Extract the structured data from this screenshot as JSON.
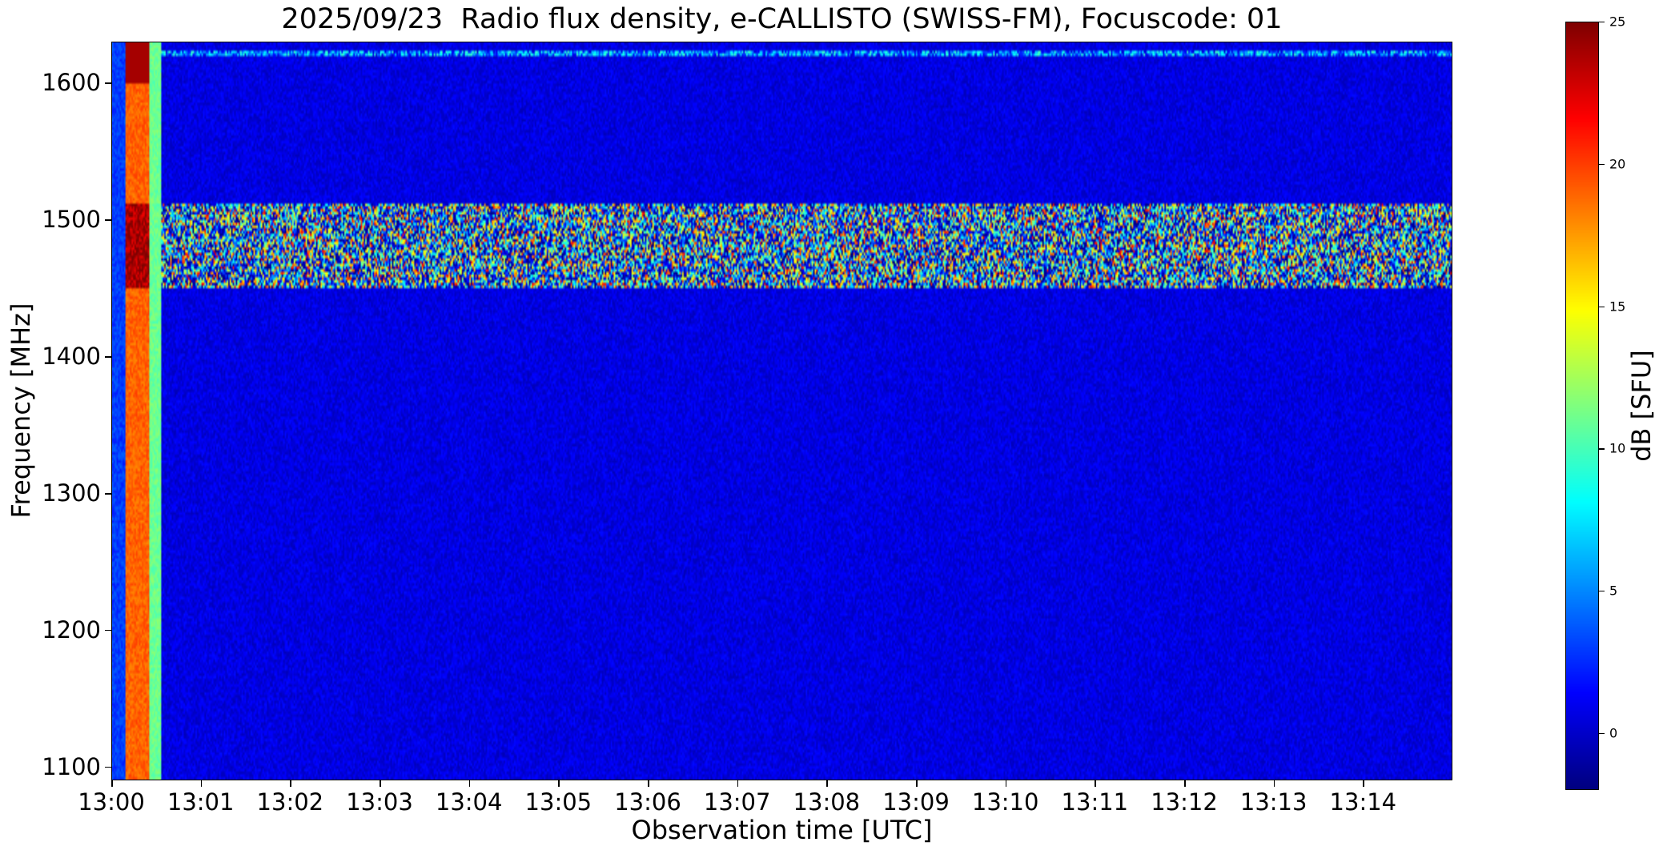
{
  "chart_data": {
    "type": "heatmap",
    "title": "2025/09/23  Radio flux density, e-CALLISTO (SWISS-FM), Focuscode: 01",
    "xlabel": "Observation time [UTC]",
    "ylabel": "Frequency [MHz]",
    "xlim": [
      "13:00",
      "13:15"
    ],
    "ylim": [
      1090,
      1630
    ],
    "x_ticks": [
      "13:00",
      "13:01",
      "13:02",
      "13:03",
      "13:04",
      "13:05",
      "13:06",
      "13:07",
      "13:08",
      "13:09",
      "13:10",
      "13:11",
      "13:12",
      "13:13",
      "13:14"
    ],
    "y_ticks": [
      1100,
      1200,
      1300,
      1400,
      1500,
      1600
    ],
    "colormap": "jet",
    "colorbar": {
      "label": "dB [SFU]",
      "range": [
        -2,
        25
      ],
      "ticks": [
        0,
        5,
        10,
        15,
        20,
        25
      ]
    },
    "background_level_db": 1,
    "features": [
      {
        "kind": "time-band",
        "time_start": "13:00:00",
        "time_end": "13:00:09",
        "level_db": 3
      },
      {
        "kind": "time-band",
        "time_start": "13:00:09",
        "time_end": "13:00:25",
        "level_db": 19
      },
      {
        "kind": "time-band",
        "time_start": "13:00:25",
        "time_end": "13:00:33",
        "level_db": 11
      },
      {
        "kind": "frequency-band-noise",
        "freq_start": 1450,
        "freq_end": 1512,
        "level_range_db": [
          -2,
          22
        ]
      },
      {
        "kind": "frequency-line",
        "freq": 1622,
        "level_range_db": [
          0,
          10
        ]
      }
    ]
  }
}
